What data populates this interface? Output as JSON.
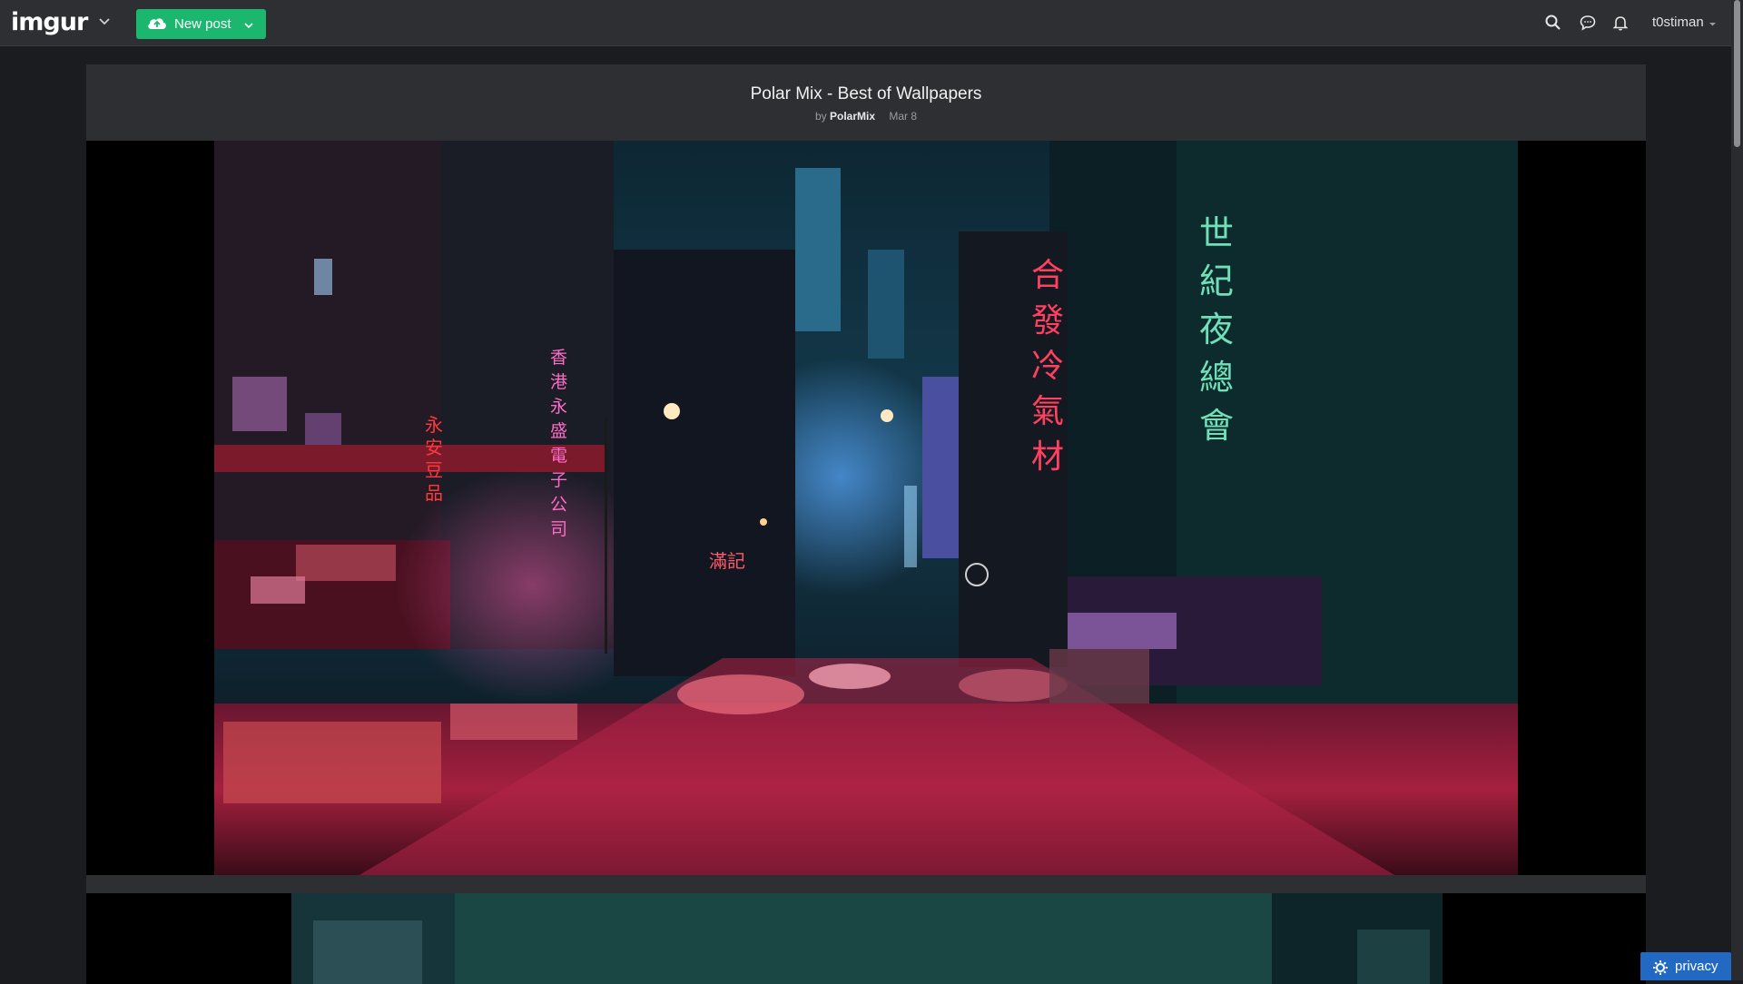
{
  "header": {
    "logo": "imgur",
    "new_post_label": "New post",
    "username": "t0stiman",
    "accent_color": "#1bb76e"
  },
  "post": {
    "title": "Polar Mix - Best of Wallpapers",
    "by_label": "by",
    "author": "PolarMix",
    "date": "Mar 8"
  },
  "neon_signs": {
    "right_tall": [
      "世",
      "紀",
      "夜",
      "總",
      "會"
    ],
    "center_red": [
      "合",
      "發",
      "冷",
      "氣",
      "材"
    ],
    "left_pink": [
      "香",
      "港",
      "永",
      "盛",
      "電",
      "子",
      "公",
      "司"
    ],
    "left_red": [
      "永",
      "安",
      "豆",
      "品"
    ],
    "lower_sign": "滿記"
  },
  "footer": {
    "privacy_label": "privacy"
  },
  "icons": [
    "logo-caret-icon",
    "cloud-upload-icon",
    "chevron-down-icon",
    "search-icon",
    "chat-bubble-icon",
    "bell-icon",
    "gear-icon"
  ]
}
